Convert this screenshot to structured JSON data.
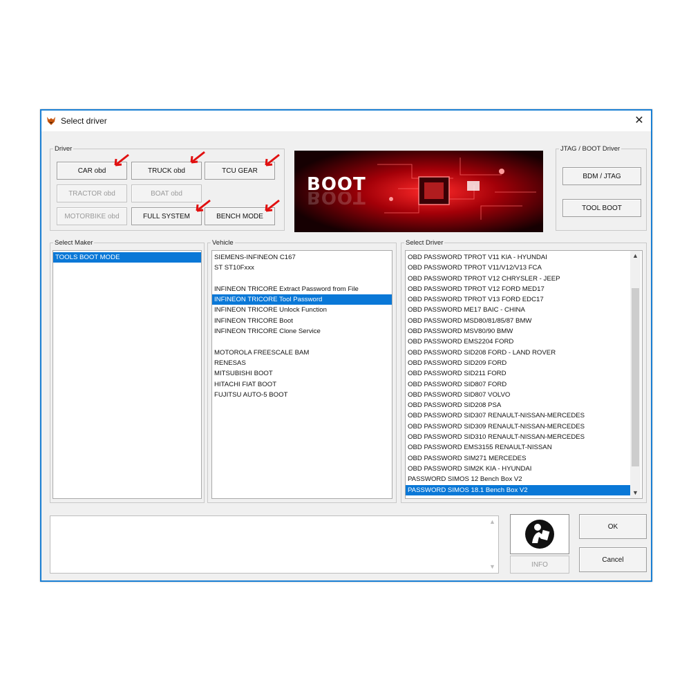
{
  "window": {
    "title": "Select driver",
    "close_glyph": "✕"
  },
  "driver_group": {
    "legend": "Driver",
    "buttons": {
      "car": "CAR obd",
      "truck": "TRUCK obd",
      "tcu": "TCU GEAR",
      "tractor": "TRACTOR obd",
      "boat": "BOAT obd",
      "motorbike": "MOTORBIKE obd",
      "full_system": "FULL SYSTEM",
      "bench_mode": "BENCH MODE"
    }
  },
  "banner": {
    "title": "BOOT"
  },
  "jtag_group": {
    "legend": "JTAG / BOOT Driver",
    "bdm_jtag": "BDM / JTAG",
    "tool_boot": "TOOL BOOT"
  },
  "maker": {
    "legend": "Select Maker",
    "items": [
      "TOOLS BOOT MODE"
    ],
    "selected_index": 0
  },
  "vehicle": {
    "legend": "Vehicle",
    "items": [
      "SIEMENS-INFINEON C167",
      "ST ST10Fxxx",
      "",
      "INFINEON TRICORE Extract Password from File",
      "INFINEON TRICORE Tool Password",
      "INFINEON TRICORE Unlock Function",
      "INFINEON TRICORE Boot",
      "INFINEON TRICORE Clone Service",
      "",
      "MOTOROLA FREESCALE BAM",
      "RENESAS",
      "MITSUBISHI BOOT",
      "HITACHI FIAT BOOT",
      "FUJITSU AUTO-5 BOOT"
    ],
    "selected_index": 4
  },
  "driver_list": {
    "legend": "Select Driver",
    "items": [
      "OBD PASSWORD TPROT V11 KIA - HYUNDAI",
      "OBD PASSWORD TPROT V11/V12/V13 FCA",
      "OBD PASSWORD TPROT V12 CHRYSLER - JEEP",
      "OBD PASSWORD TPROT V12 FORD MED17",
      "OBD PASSWORD TPROT V13 FORD EDC17",
      "OBD PASSWORD ME17 BAIC - CHINA",
      "OBD PASSWORD MSD80/81/85/87 BMW",
      "OBD PASSWORD MSV80/90 BMW",
      "OBD PASSWORD EMS2204 FORD",
      "OBD PASSWORD SID208 FORD - LAND ROVER",
      "OBD PASSWORD SID209 FORD",
      "OBD PASSWORD SID211 FORD",
      "OBD PASSWORD SID807 FORD",
      "OBD PASSWORD SID807 VOLVO",
      "OBD PASSWORD SID208 PSA",
      "OBD PASSWORD SID307 RENAULT-NISSAN-MERCEDES",
      "OBD PASSWORD SID309 RENAULT-NISSAN-MERCEDES",
      "OBD PASSWORD SID310 RENAULT-NISSAN-MERCEDES",
      "OBD PASSWORD EMS3155 RENAULT-NISSAN",
      "OBD PASSWORD SIM271 MERCEDES",
      "OBD PASSWORD SIM2K KIA - HYUNDAI",
      "PASSWORD SIMOS 12 Bench Box V2",
      "PASSWORD SIMOS 18.1 Bench Box V2"
    ],
    "selected_index": 22
  },
  "bottom": {
    "info_label": "INFO",
    "ok_label": "OK",
    "cancel_label": "Cancel"
  },
  "colors": {
    "accent": "#0a78d7",
    "window_border": "#1a7fd4",
    "annotation_arrow": "#e11010"
  },
  "icons": {
    "app": "fox-logo-icon",
    "info": "reading-person-icon",
    "arrow": "red-arrow-annotation"
  }
}
